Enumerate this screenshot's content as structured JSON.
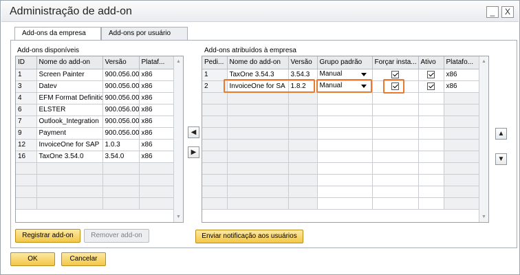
{
  "window": {
    "title": "Administração de add-on"
  },
  "tabs": [
    {
      "label": "Add-ons da empresa"
    },
    {
      "label": "Add-ons por usuário"
    }
  ],
  "left": {
    "label": "Add-ons disponíveis",
    "columns": [
      "ID",
      "Nome do add-on",
      "Versão",
      "Plataf..."
    ],
    "rows": [
      [
        "1",
        "Screen Painter",
        "900.056.00.",
        "x86"
      ],
      [
        "3",
        "Datev",
        "900.056.00.",
        "x86"
      ],
      [
        "4",
        "EFM Format Definitic",
        "900.056.00.",
        "x86"
      ],
      [
        "6",
        "ELSTER",
        "900.056.00.",
        "x86"
      ],
      [
        "7",
        "Outlook_Integration",
        "900.056.00.",
        "x86"
      ],
      [
        "9",
        "Payment",
        "900.056.00.",
        "x86"
      ],
      [
        "12",
        "InvoiceOne for SAP",
        "1.0.3",
        "x86"
      ],
      [
        "16",
        "TaxOne 3.54.0",
        "3.54.0",
        "x86"
      ]
    ]
  },
  "right": {
    "label": "Add-ons atribuídos à empresa",
    "columns": [
      "Pedi...",
      "Nome do add-on",
      "Versão",
      "Grupo padrão",
      "Forçar insta...",
      "Ativo",
      "Platafo..."
    ],
    "rows": [
      {
        "order": "1",
        "name": "TaxOne 3.54.3",
        "version": "3.54.3",
        "group": "Manual",
        "force": true,
        "active": true,
        "platform": "x86"
      },
      {
        "order": "2",
        "name": "InvoiceOne for SA",
        "version": "1.8.2",
        "group": "Manual",
        "force": true,
        "active": true,
        "platform": "x86"
      }
    ]
  },
  "buttons": {
    "register": "Registrar add-on",
    "remove": "Remover add-on",
    "notify": "Enviar notificação aos usuários",
    "ok": "OK",
    "cancel": "Cancelar",
    "minimize": "_",
    "close": "X"
  },
  "icons": {
    "move_left": "arrow-left-icon",
    "move_right": "arrow-right-icon",
    "move_up": "arrow-up-icon",
    "move_down": "arrow-down-icon"
  },
  "colors": {
    "highlight": "#e8792d",
    "button": "#f3c747"
  }
}
